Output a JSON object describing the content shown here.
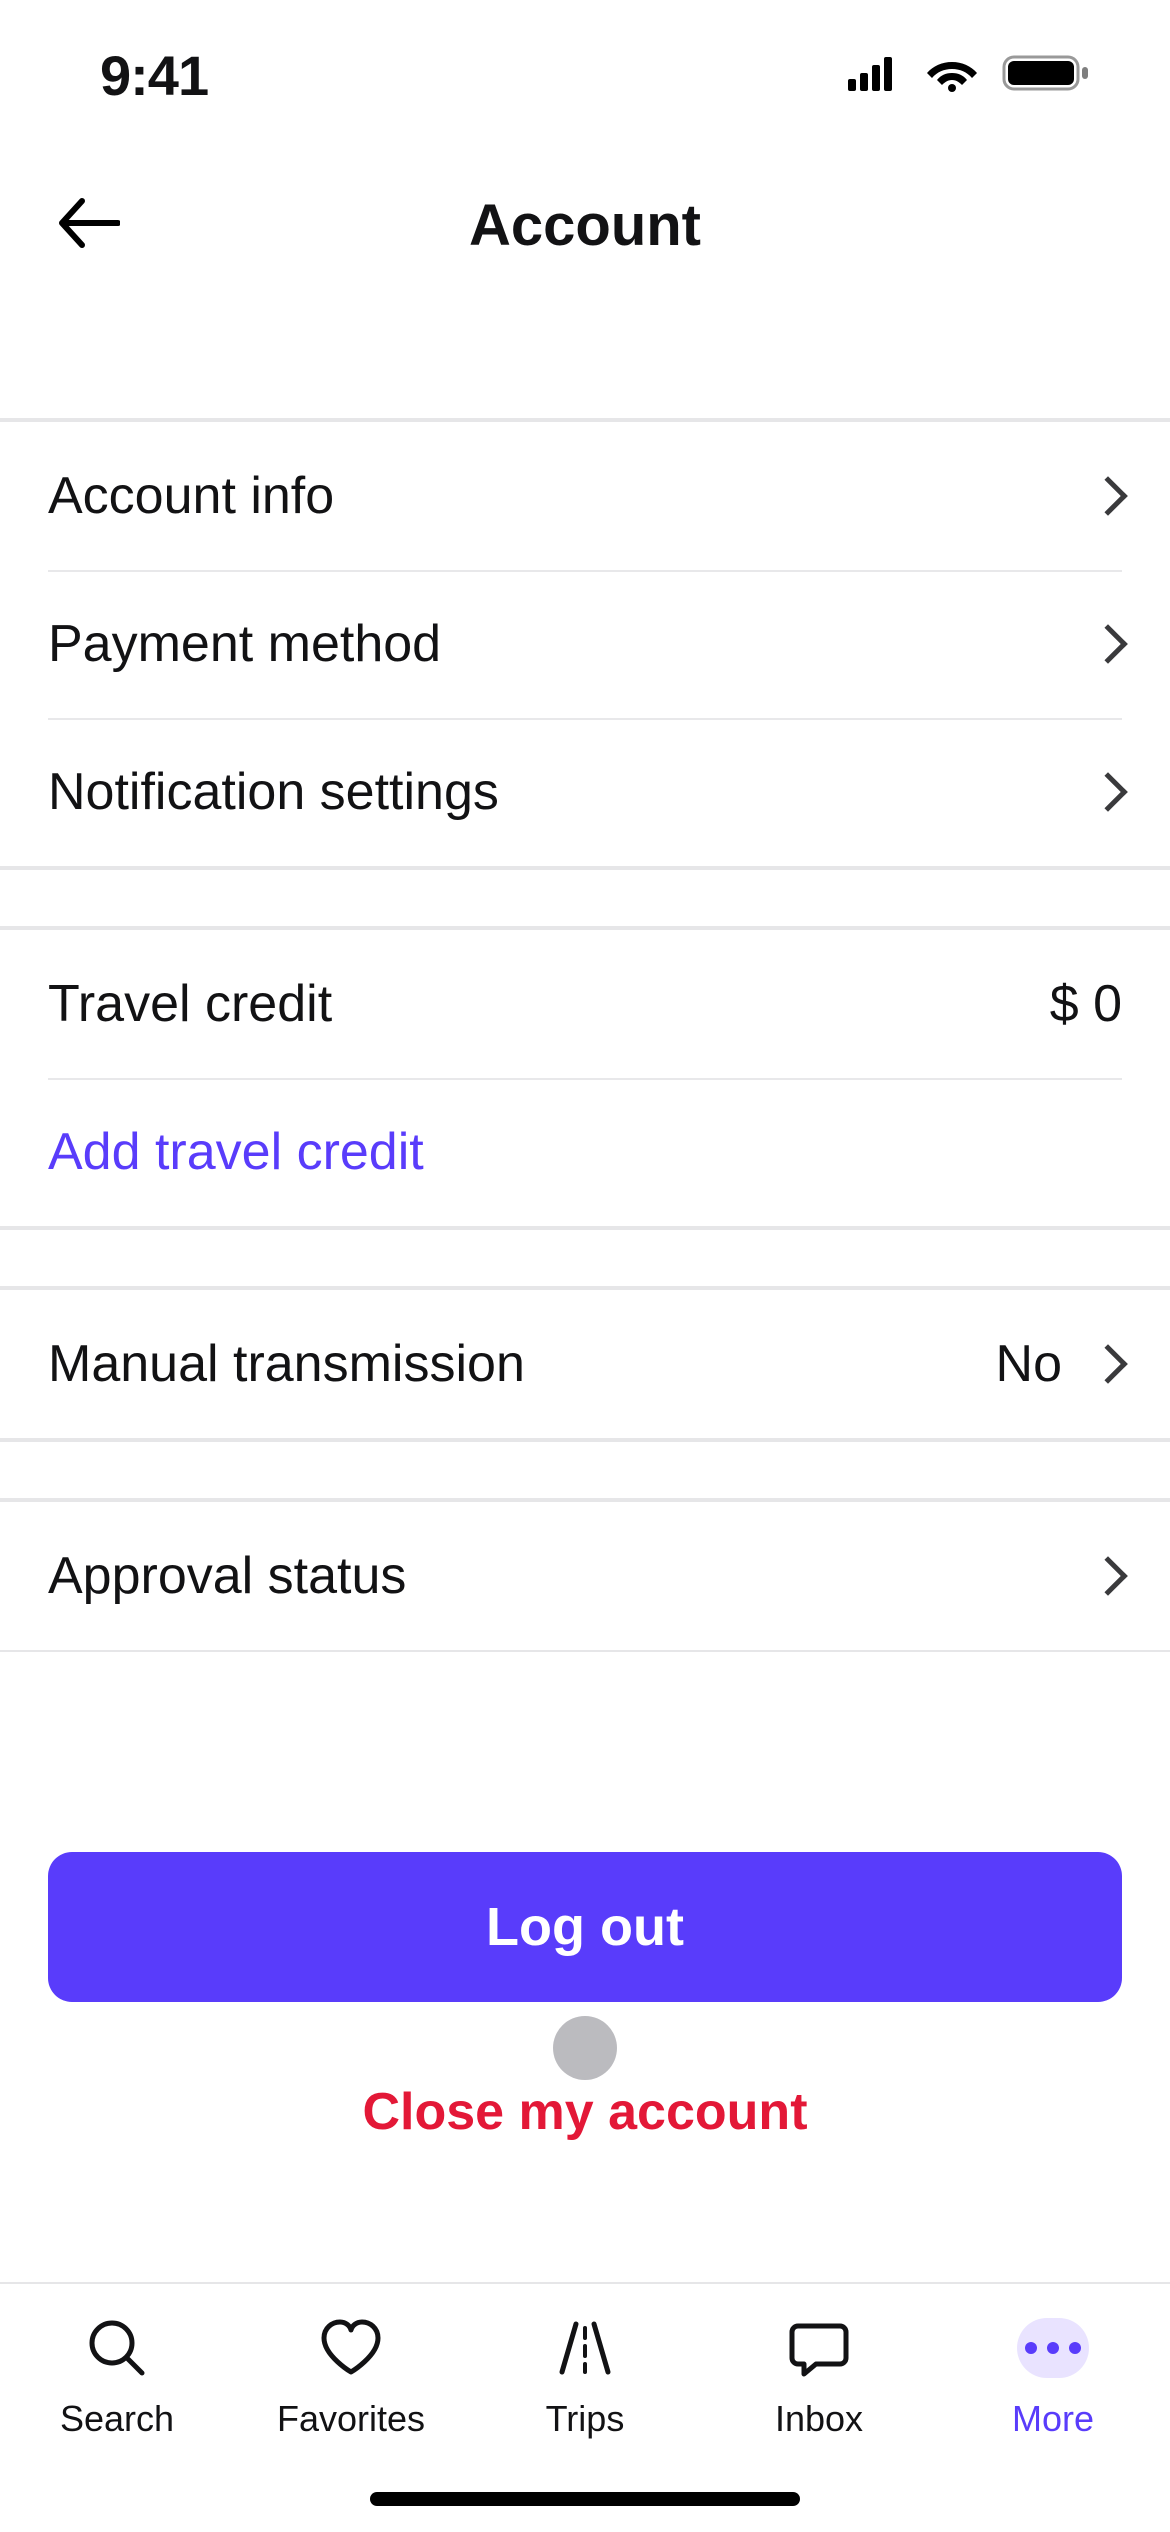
{
  "status": {
    "time": "9:41"
  },
  "header": {
    "title": "Account"
  },
  "sections": {
    "account": {
      "items": [
        {
          "label": "Account info"
        },
        {
          "label": "Payment method"
        },
        {
          "label": "Notification settings"
        }
      ]
    },
    "credit": {
      "label": "Travel credit",
      "value": "$ 0",
      "link": "Add travel credit"
    },
    "transmission": {
      "label": "Manual transmission",
      "value": "No"
    },
    "approval": {
      "label": "Approval status"
    }
  },
  "buttons": {
    "logout": "Log out",
    "close_account": "Close my account"
  },
  "tabs": [
    {
      "label": "Search"
    },
    {
      "label": "Favorites"
    },
    {
      "label": "Trips"
    },
    {
      "label": "Inbox"
    },
    {
      "label": "More"
    }
  ]
}
